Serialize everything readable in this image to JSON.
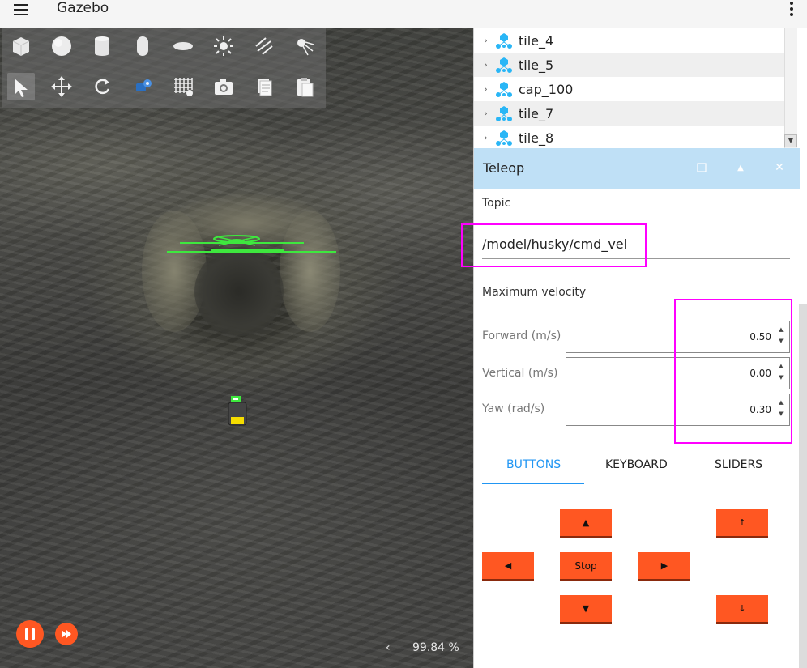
{
  "app": {
    "title": "Gazebo"
  },
  "toolbar": {
    "tools": [
      {
        "icon": "box-icon"
      },
      {
        "icon": "sphere-icon"
      },
      {
        "icon": "cylinder-icon"
      },
      {
        "icon": "capsule-icon"
      },
      {
        "icon": "ellipsoid-icon"
      },
      {
        "icon": "point-light-icon"
      },
      {
        "icon": "directional-light-icon"
      },
      {
        "icon": "spot-light-icon"
      },
      {
        "icon": "select-icon"
      },
      {
        "icon": "translate-icon"
      },
      {
        "icon": "rotate-icon"
      },
      {
        "icon": "transform-control-icon"
      },
      {
        "icon": "grid-icon"
      },
      {
        "icon": "camera-icon"
      },
      {
        "icon": "copy-icon"
      },
      {
        "icon": "paste-icon"
      }
    ]
  },
  "simulation": {
    "rtf": "99.84 %",
    "rtf_arrow": "‹"
  },
  "entity_tree": {
    "items": [
      {
        "label": "tile_4"
      },
      {
        "label": "tile_5"
      },
      {
        "label": "cap_100"
      },
      {
        "label": "tile_7"
      },
      {
        "label": "tile_8"
      }
    ]
  },
  "teleop": {
    "title": "Teleop",
    "topic_label": "Topic",
    "topic_value": "/model/husky/cmd_vel",
    "max_velocity_label": "Maximum velocity",
    "velocities": [
      {
        "label": "Forward (m/s)",
        "value": "0.50"
      },
      {
        "label": "Vertical (m/s)",
        "value": "0.00"
      },
      {
        "label": "Yaw (rad/s)",
        "value": "0.30"
      }
    ],
    "tabs": [
      "BUTTONS",
      "KEYBOARD",
      "SLIDERS"
    ],
    "active_tab": "BUTTONS",
    "buttons": {
      "forward": "▲",
      "left": "◀",
      "stop": "Stop",
      "right": "▶",
      "backward": "▼",
      "up": "↑",
      "down": "↓"
    }
  },
  "colors": {
    "accent": "#ff5722",
    "header": "#bfe0f6",
    "tab_active": "#2196f3",
    "highlight": "#ff00ff"
  }
}
